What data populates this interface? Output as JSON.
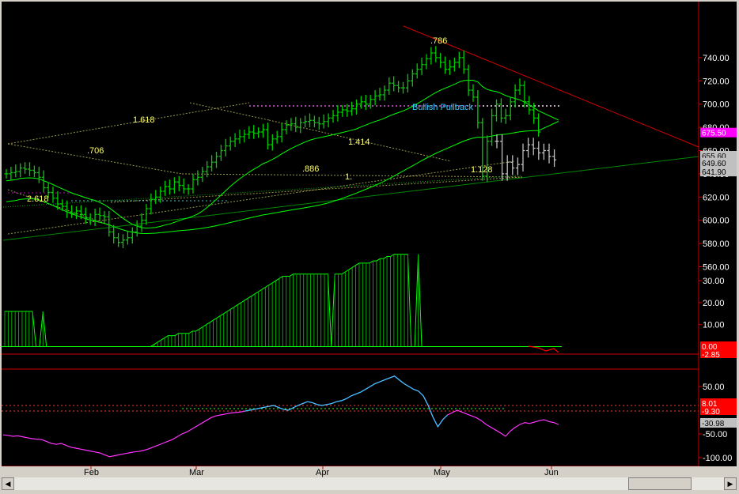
{
  "chart_data": [
    {
      "type": "ohlc",
      "panel": "price",
      "y_ticks": [
        560,
        580,
        600,
        620,
        640,
        660,
        680,
        700,
        720,
        740
      ],
      "ylim": [
        550,
        750
      ],
      "x_labels": [
        "Feb",
        "Mar",
        "Apr",
        "May",
        "Jun"
      ],
      "price_tags": [
        {
          "value": "675.50",
          "color": "#ff00ff"
        },
        {
          "value": "655.60",
          "color": "#c0c0c0"
        },
        {
          "value": "649.60",
          "color": "#c0c0c0"
        },
        {
          "value": "641.90",
          "color": "#c0c0c0"
        }
      ],
      "fib_labels": [
        ".786",
        "1.618",
        ".706",
        "1.414",
        ".886",
        "1.",
        "1.128",
        "2.618"
      ],
      "annotation": "Bullish Pullback",
      "colors": {
        "bars": "#00cc00",
        "projected_bars": "#c0c0c0",
        "moving_avg": "#00ff00",
        "trendline_upper": "#cc0000",
        "trendline_lower": "#008800",
        "fib": "#cccc66"
      },
      "series": [
        {
          "name": "Close",
          "values": [
            640,
            641,
            642,
            645,
            644,
            643,
            641,
            637,
            628,
            624,
            619,
            614,
            612,
            607,
            606,
            608,
            605,
            602,
            600,
            605,
            604,
            603,
            590,
            585,
            581,
            583,
            585,
            590,
            595,
            600,
            610,
            618,
            620,
            625,
            629,
            627,
            633,
            630,
            627,
            627,
            635,
            637,
            642,
            646,
            650,
            655,
            660,
            664,
            668,
            670,
            672,
            674,
            676,
            675,
            676,
            678,
            665,
            670,
            672,
            678,
            682,
            683,
            680,
            684,
            685,
            686,
            684,
            683,
            685,
            688,
            690,
            693,
            695,
            694,
            696,
            700,
            702,
            700,
            704,
            707,
            708,
            712,
            718,
            716,
            714,
            714,
            720,
            726,
            730,
            734,
            739,
            744,
            740,
            736,
            730,
            732,
            736,
            740,
            730,
            712,
            706,
            684,
            638,
            668,
            690,
            700,
            688,
            690,
            702,
            712,
            716,
            702,
            695,
            688,
            676
          ]
        },
        {
          "name": "Projected",
          "values": [
            668,
            640,
            650,
            645,
            648,
            660,
            665,
            662,
            658,
            660,
            655,
            652
          ]
        }
      ]
    },
    {
      "type": "histogram",
      "panel": "oscillator",
      "y_ticks": [
        10,
        20,
        30
      ],
      "zero_tags": [
        {
          "value": "0.00",
          "color": "#ff0000"
        },
        {
          "value": "-2.85",
          "color": "#ff0000"
        }
      ],
      "values": [
        16,
        16,
        16,
        16,
        16,
        16,
        16,
        16,
        16,
        0,
        0,
        16,
        0,
        0,
        0,
        0,
        0,
        0,
        0,
        0,
        0,
        0,
        0,
        0,
        0,
        0,
        0,
        0,
        0,
        0,
        0,
        0,
        0,
        0,
        0,
        0,
        0,
        0,
        0,
        0,
        0,
        0,
        0,
        1,
        2,
        3,
        4,
        5,
        5,
        5,
        6,
        6,
        6,
        6,
        7,
        7,
        8,
        9,
        10,
        11,
        12,
        13,
        14,
        15,
        16,
        17,
        18,
        19,
        20,
        21,
        22,
        23,
        24,
        25,
        26,
        27,
        28,
        29,
        30,
        31,
        32,
        32,
        32,
        33,
        33,
        33,
        33,
        33,
        33,
        33,
        33,
        33,
        33,
        33,
        0,
        33,
        33,
        33,
        34,
        35,
        36,
        37,
        38,
        38,
        38,
        38,
        39,
        39,
        40,
        40,
        41,
        41,
        42,
        42,
        42,
        42,
        42,
        0,
        0,
        42,
        0
      ]
    },
    {
      "type": "line",
      "panel": "momentum",
      "y_ticks": [
        -100,
        -50,
        50
      ],
      "levels": [
        "8.01",
        "-9.30"
      ],
      "current": "-30.98",
      "values": [
        -52,
        -53,
        -55,
        -54,
        -56,
        -58,
        -60,
        -61,
        -62,
        -66,
        -70,
        -72,
        -70,
        -74,
        -78,
        -80,
        -82,
        -84,
        -86,
        -88,
        -90,
        -94,
        -98,
        -96,
        -94,
        -92,
        -90,
        -88,
        -87,
        -85,
        -82,
        -78,
        -74,
        -70,
        -66,
        -62,
        -56,
        -50,
        -46,
        -40,
        -34,
        -28,
        -22,
        -16,
        -12,
        -10,
        -8,
        -6,
        -5,
        -4,
        -2,
        0,
        2,
        4,
        6,
        8,
        10,
        6,
        2,
        0,
        5,
        10,
        14,
        18,
        16,
        12,
        10,
        12,
        14,
        18,
        20,
        24,
        30,
        34,
        38,
        44,
        50,
        56,
        60,
        64,
        68,
        72,
        64,
        56,
        50,
        44,
        40,
        30,
        10,
        -15,
        -35,
        -20,
        -10,
        -5,
        0,
        -4,
        -8,
        -12,
        -16,
        -22,
        -30,
        -36,
        -42,
        -48,
        -55,
        -44,
        -36,
        -30,
        -26,
        -28,
        -25,
        -22,
        -20,
        -24,
        -26,
        -30
      ]
    }
  ]
}
